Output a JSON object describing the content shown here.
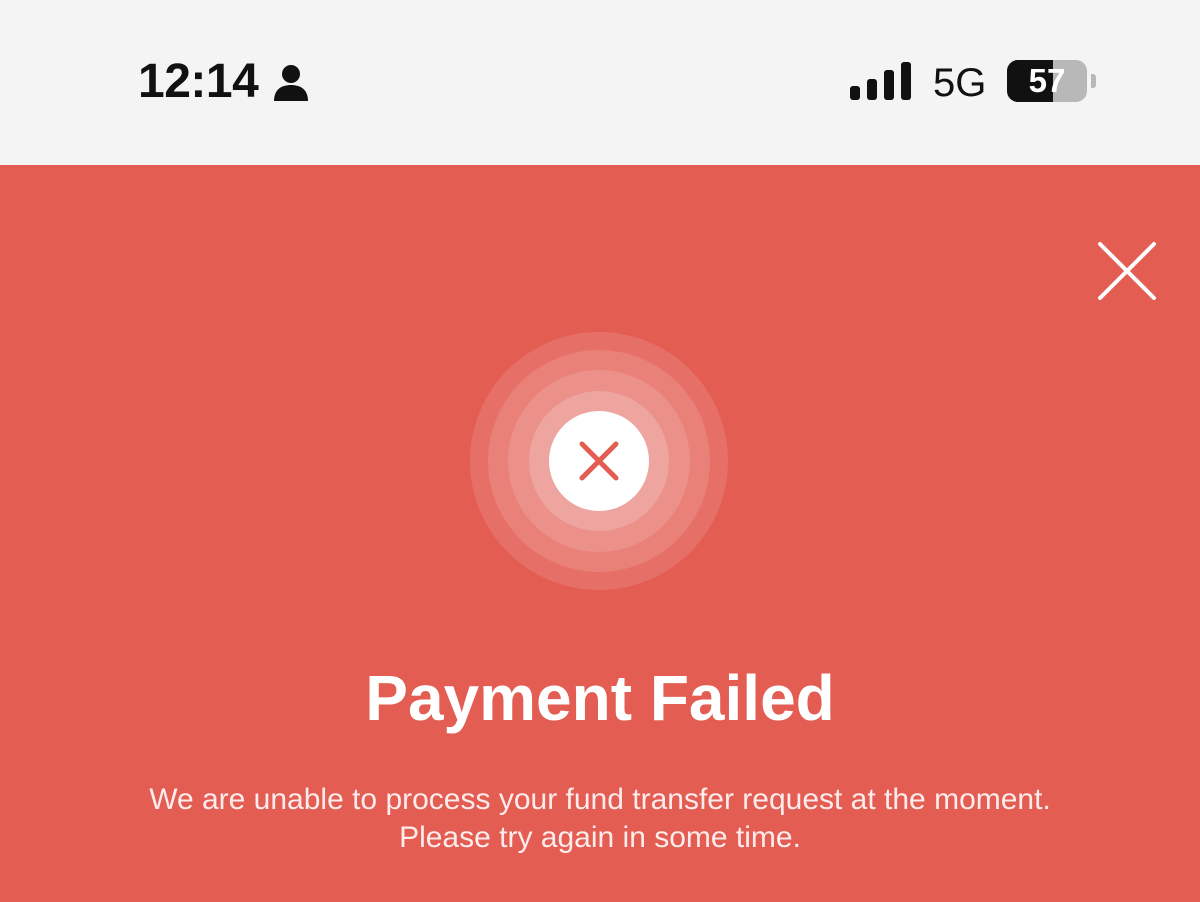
{
  "status_bar": {
    "time": "12:14",
    "network": "5G",
    "battery_level": "57",
    "battery_fraction": 0.57,
    "icons": [
      "person-icon",
      "signal-bars-icon",
      "battery-icon"
    ]
  },
  "dialog": {
    "close_icon": "close-icon",
    "status_icon": "error-x-icon",
    "title": "Payment Failed",
    "message_line1": "We are unable to process your fund transfer request at the moment.",
    "message_line2": "Please try again in some time."
  },
  "colors": {
    "background": "#e35d53",
    "status_bar": "#f4f4f4",
    "error_icon": "#e35d53",
    "text": "#ffffff"
  }
}
